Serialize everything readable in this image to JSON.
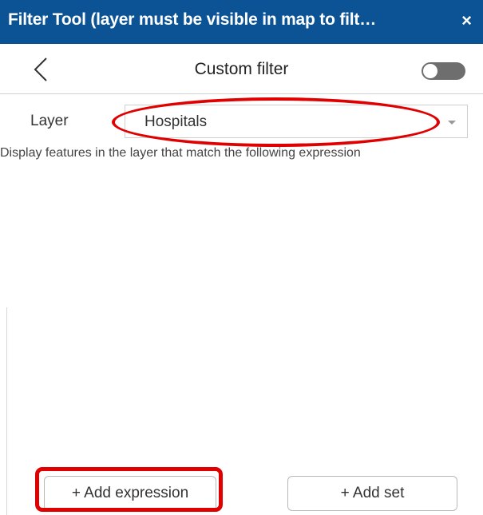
{
  "header": {
    "title": "Filter Tool (layer must be visible in map to filt…",
    "close_icon": "close-icon",
    "close_glyph": "×",
    "background_color": "#0b5394"
  },
  "subbar": {
    "back_icon": "chevron-left-icon",
    "title": "Custom filter",
    "toggle_state": "off"
  },
  "layer": {
    "label": "Layer",
    "selected": "Hospitals"
  },
  "description": "Display features in the layer that match the following expression",
  "buttons": {
    "add_expression": "+ Add expression",
    "add_set": "+ Add set"
  },
  "annotations": {
    "highlight_color": "#e00000"
  }
}
